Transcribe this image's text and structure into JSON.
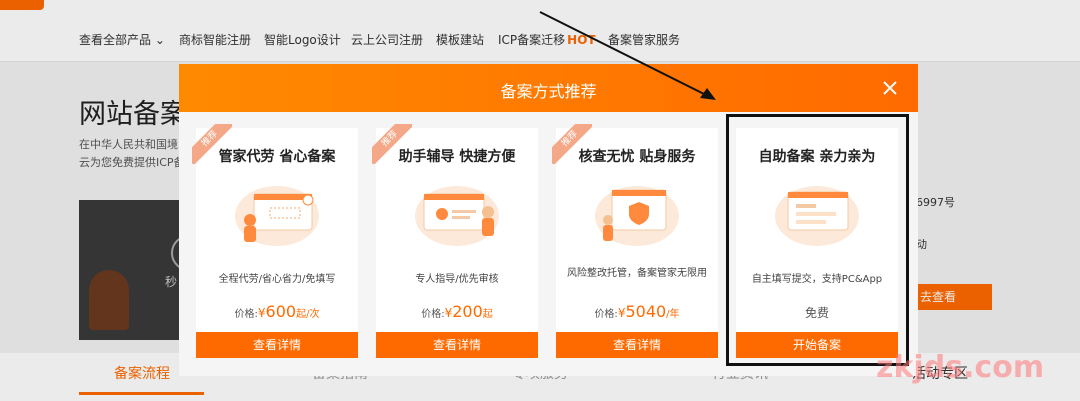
{
  "nav": {
    "items": [
      "查看全部产品 ⌄",
      "商标智能注册",
      "智能Logo设计",
      "云上公司注册",
      "模板建站",
      "ICP备案迁移",
      "备案管家服务"
    ],
    "hot_label": "HOT"
  },
  "hero": {
    "title": "网站备案",
    "desc_line1": "在中华人民共和国境",
    "desc_line2": "云为您免费提供ICP备",
    "video_caption": "秒"
  },
  "side": {
    "number_frag": "6997号",
    "text_frag": "动",
    "button_frag": "去查看"
  },
  "bottom_tabs": {
    "flow": "备案流程",
    "frag2": "备案指南",
    "frag3": "专项服务",
    "frag4": "行业资讯",
    "frag5": "活动专区"
  },
  "modal": {
    "title": "备案方式推荐",
    "cards": [
      {
        "badge": "推荐",
        "title": "管家代劳 省心备案",
        "desc": "全程代劳/省心省力/免填写",
        "price_label": "价格:",
        "price": "600",
        "price_unit": "起/次",
        "button": "查看详情"
      },
      {
        "badge": "推荐",
        "title": "助手辅导 快捷方便",
        "desc": "专人指导/优先审核",
        "price_label": "价格:",
        "price": "200",
        "price_unit": "起",
        "button": "查看详情"
      },
      {
        "badge": "推荐",
        "title": "核查无忧 贴身服务",
        "desc": "风险整改托管，备案管家无限用",
        "price_label": "价格:",
        "price": "5040",
        "price_unit": "/年",
        "button": "查看详情"
      },
      {
        "title": "自助备案 亲力亲为",
        "desc": "自主填写提交，支持PC&App",
        "price_free": "免费",
        "button": "开始备案"
      }
    ]
  },
  "currency_symbol": "¥",
  "watermark": "zkjds.com",
  "colors": {
    "accent": "#ff6a00",
    "badge": "#f5a888"
  }
}
